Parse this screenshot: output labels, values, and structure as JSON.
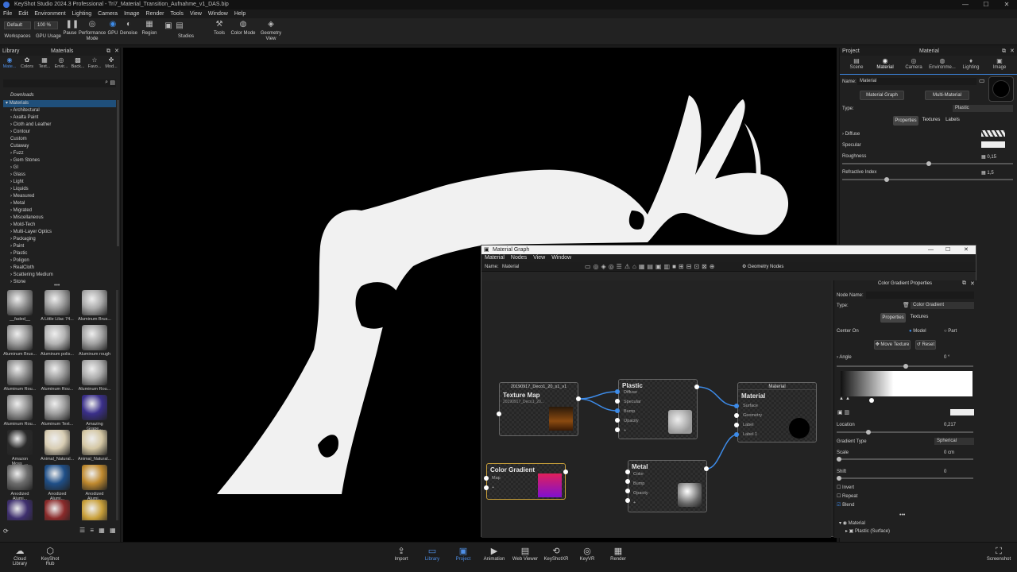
{
  "window": {
    "title": "KeyShot Studio 2024.3 Professional - Tri7_Material_Transition_Aufnahme_v1_DAS.bip",
    "minimize": "—",
    "maximize": "☐",
    "close": "✕"
  },
  "menu": [
    "File",
    "Edit",
    "Environment",
    "Lighting",
    "Camera",
    "Image",
    "Render",
    "Tools",
    "View",
    "Window",
    "Help"
  ],
  "toolbar": {
    "workspace_value": "Default",
    "zoom_value": "100 %",
    "items": [
      {
        "label": "Workspaces",
        "icon": "workspaces-icon"
      },
      {
        "label": "GPU Usage",
        "icon": "gpu-usage-icon"
      },
      {
        "label": "Pause",
        "icon": "pause-icon"
      },
      {
        "label": "Performance Mode",
        "icon": "performance-icon"
      },
      {
        "label": "GPU",
        "icon": "gpu-icon"
      },
      {
        "label": "Denoise",
        "icon": "denoise-icon"
      },
      {
        "label": "Region",
        "icon": "region-icon"
      },
      {
        "label": "Studios",
        "icon": "studios-icon"
      },
      {
        "label": "Tools",
        "icon": "tools-icon"
      },
      {
        "label": "Color Mode",
        "icon": "color-mode-icon"
      },
      {
        "label": "Geometry View",
        "icon": "geometry-view-icon"
      }
    ]
  },
  "library": {
    "panel_label": "Library",
    "title": "Materials",
    "tabs": [
      "Mate...",
      "Colors",
      "Text...",
      "Envir...",
      "Back...",
      "Favo...",
      "Mod..."
    ],
    "tree_header": "Downloads",
    "tree_root": "Materials",
    "tree": [
      "Architectural",
      "Axalta Paint",
      "Cloth and Leather",
      "Contour",
      "Custom",
      "Cutaway",
      "Fuzz",
      "Gem Stones",
      "GI",
      "Glass",
      "Light",
      "Liquids",
      "Measured",
      "Metal",
      "Migrated",
      "Miscellaneous",
      "Mold-Tech",
      "Multi-Layer Optics",
      "Packaging",
      "Paint",
      "Plastic",
      "Poligon",
      "RealCloth",
      "Scattering Medium",
      "Stone"
    ],
    "thumbnails": [
      "__faded__",
      "A Little Lilac 74...",
      "Aluminum Brus...",
      "Aluminum Brus...",
      "Aluminum polis...",
      "Aluminum rough",
      "Aluminum Rou...",
      "Aluminum Rou...",
      "Aluminum Rou...",
      "Aluminum Rou...",
      "Aluminum Text...",
      "Amazing Grape...",
      "Amazon Moss_...",
      "Animal_Natural...",
      "Animal_Natural...",
      "Anodized Alumi...",
      "Anodized Alumi...",
      "Anodized Alumi...",
      "",
      "",
      ""
    ],
    "thumb_colors": [
      "#8e8e8e",
      "#9a9a9a",
      "#a9a9a9",
      "#9c9c9c",
      "#b4b4b4",
      "#a2a2a2",
      "#8f8f8f",
      "#9b9b9b",
      "#aaaaaa",
      "#959595",
      "#a0a0a0",
      "#3a2f8a",
      "#2a2a2a",
      "#d8cdb3",
      "#d4c7a4",
      "#6d6d6d",
      "#1f4f88",
      "#c08a2f",
      "#3e2f6e",
      "#8a2a2a",
      "#c9a03a"
    ]
  },
  "project": {
    "panel_label": "Project",
    "title": "Material",
    "tabs": [
      "Scene",
      "Material",
      "Camera",
      "Environme...",
      "Lighting",
      "Image"
    ],
    "name_label": "Name:",
    "name_value": "Material",
    "material_graph_btn": "Material Graph",
    "multi_material_btn": "Multi-Material",
    "type_label": "Type:",
    "type_value": "Plastic",
    "subtabs": [
      "Properties",
      "Textures",
      "Labels"
    ],
    "diffuse_label": "Diffuse",
    "specular_label": "Specular",
    "roughness_label": "Roughness",
    "roughness_value": "0,15",
    "roughness_fraction": 0.15,
    "refractive_label": "Refractive Index",
    "refractive_value": "1,5",
    "refractive_fraction": 0.25
  },
  "graph": {
    "title": "Material Graph",
    "menu": [
      "Material",
      "Nodes",
      "View",
      "Window"
    ],
    "name_label": "Name:",
    "name_value": "Material",
    "geometry_nodes": "Geometry Nodes",
    "nodes": {
      "texture": {
        "header": "20190917_Deco1_20_s1_v1",
        "title": "Texture Map",
        "sub": "20190917_Deco1_20..."
      },
      "plastic": {
        "title": "Plastic",
        "pins": [
          "Diffuse",
          "Specular",
          "Bump",
          "Opacity",
          "+"
        ]
      },
      "material": {
        "header": "Material",
        "title": "Material",
        "pins": [
          "Surface",
          "Geometry",
          "Label",
          "Label 1"
        ]
      },
      "gradient": {
        "title": "Color Gradient",
        "pins": [
          "Map",
          "+"
        ]
      },
      "metal": {
        "title": "Metal",
        "pins": [
          "Color",
          "Bump",
          "Opacity",
          "+"
        ]
      }
    },
    "props": {
      "title": "Color Gradient Properties",
      "node_name_label": "Node Name:",
      "type_label": "Type:",
      "type_value": "Color Gradient",
      "tabs": [
        "Properties",
        "Textures"
      ],
      "center_on_label": "Center On",
      "center_options": [
        "Model",
        "Part"
      ],
      "move_texture": "Move Texture",
      "reset": "Reset",
      "angle_label": "Angle",
      "angle_value": "0 °",
      "location_label": "Location",
      "location_value": "0,217",
      "location_fraction": 0.217,
      "gradient_type_label": "Gradient Type",
      "gradient_type_value": "Spherical",
      "scale_label": "Scale",
      "scale_value": "0 cm",
      "shift_label": "Shift",
      "shift_value": "0",
      "checks": [
        {
          "label": "Invert",
          "checked": false
        },
        {
          "label": "Repeat",
          "checked": false
        },
        {
          "label": "Blend",
          "checked": true
        }
      ],
      "tree": [
        "Material",
        "Plastic (Surface)"
      ]
    }
  },
  "bottom": {
    "left": [
      {
        "label": "Cloud Library",
        "icon": "cloud-library-icon"
      },
      {
        "label": "KeyShot Hub",
        "icon": "hub-icon"
      }
    ],
    "center": [
      {
        "label": "Import",
        "icon": "import-icon",
        "active": false
      },
      {
        "label": "Library",
        "icon": "library-icon",
        "active": true
      },
      {
        "label": "Project",
        "icon": "project-icon",
        "active": true
      },
      {
        "label": "Animation",
        "icon": "animation-icon",
        "active": false
      },
      {
        "label": "Web Viewer",
        "icon": "web-viewer-icon",
        "active": false
      },
      {
        "label": "KeyShotXR",
        "icon": "keyshotxr-icon",
        "active": false
      },
      {
        "label": "KeyVR",
        "icon": "keyvr-icon",
        "active": false
      },
      {
        "label": "Render",
        "icon": "render-icon",
        "active": false
      }
    ],
    "right": {
      "label": "Screenshot",
      "icon": "screenshot-icon"
    }
  },
  "colors": {
    "accent": "#3d8be8",
    "selection": "#1f4f7a",
    "viewport_bg": "#000000",
    "model": "#f2f2f2"
  }
}
